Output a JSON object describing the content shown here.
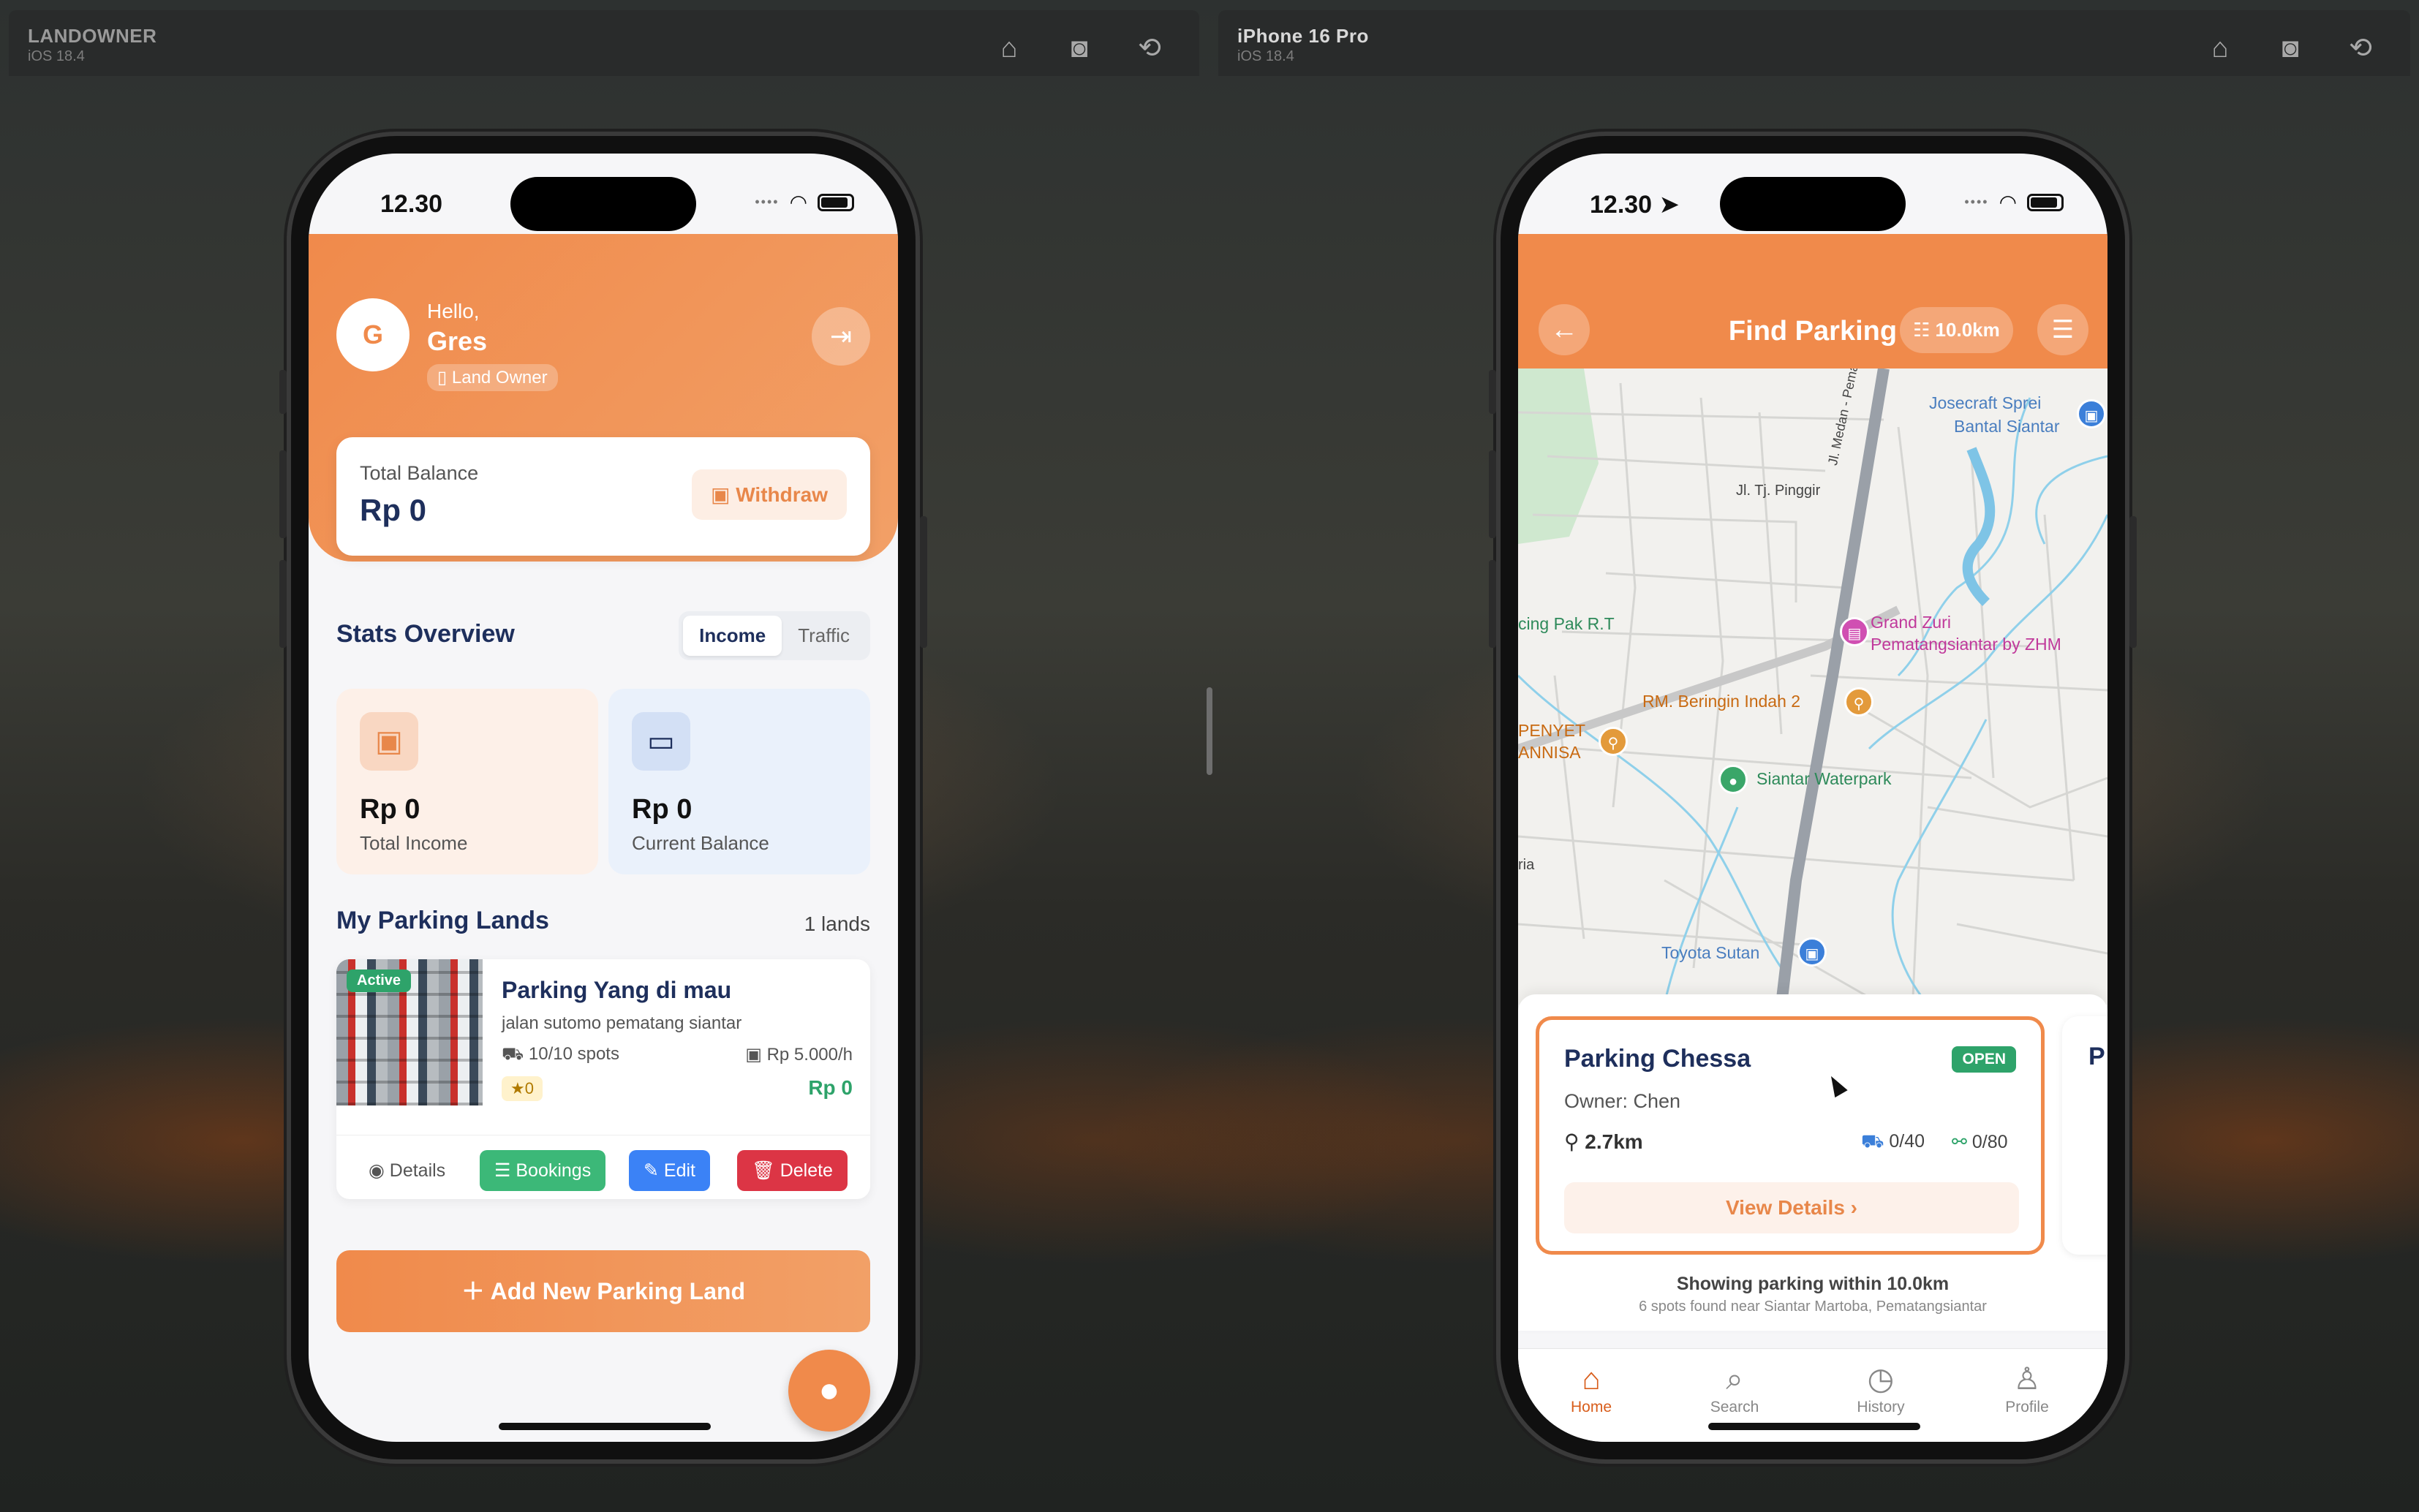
{
  "left_sim": {
    "title": "LANDOWNER",
    "os": "iOS 18.4"
  },
  "right_sim": {
    "title": "iPhone 16 Pro",
    "os": "iOS 18.4"
  },
  "sim_icons": [
    "home-icon",
    "screenshot-icon",
    "rotate-icon"
  ],
  "left_phone": {
    "time": "12.30",
    "user": {
      "initial": "G",
      "greeting": "Hello,",
      "name": "Gres",
      "role": "Land Owner"
    },
    "balance": {
      "label": "Total Balance",
      "value": "Rp 0",
      "withdraw_label": "Withdraw"
    },
    "stats": {
      "title": "Stats Overview",
      "tabs": [
        "Income",
        "Traffic"
      ],
      "active_tab": "Income",
      "cards": [
        {
          "value": "Rp 0",
          "label": "Total Income",
          "icon": "money-icon"
        },
        {
          "value": "Rp 0",
          "label": "Current Balance",
          "icon": "card-icon"
        }
      ]
    },
    "lands": {
      "title": "My Parking Lands",
      "count": "1 lands",
      "items": [
        {
          "status": "Active",
          "name": "Parking Yang di mau",
          "address": "jalan sutomo pematang siantar",
          "spots": "10/10 spots",
          "price": "Rp 5.000/h",
          "rating": "0",
          "earnings": "Rp 0",
          "actions": {
            "details": "Details",
            "bookings": "Bookings",
            "edit": "Edit",
            "delete": "Delete"
          }
        }
      ]
    },
    "add_button": "Add New Parking Land"
  },
  "right_phone": {
    "time": "12.30",
    "header": {
      "title": "Find Parking",
      "radius": "10.0km"
    },
    "map": {
      "labels": [
        {
          "text": "Josecraft Sprei",
          "kind": "poi-blue"
        },
        {
          "text": "Bantal Siantar",
          "kind": "poi-blue"
        },
        {
          "text": "Jl. Tj. Pinggir",
          "kind": "road"
        },
        {
          "text": "Jl. Medan - Pematang S",
          "kind": "road"
        },
        {
          "text": "cing Pak R.T",
          "kind": "poi-green"
        },
        {
          "text": "Grand Zuri",
          "kind": "poi-pink"
        },
        {
          "text": "Pematangsiantar by ZHM",
          "kind": "poi-pink"
        },
        {
          "text": "RM. Beringin Indah 2",
          "kind": "poi-orange"
        },
        {
          "text": "PENYET",
          "kind": "poi-orange"
        },
        {
          "text": "ANNISA",
          "kind": "poi-orange"
        },
        {
          "text": "Siantar Waterpark",
          "kind": "poi-green"
        },
        {
          "text": "ria",
          "kind": "road"
        },
        {
          "text": "Toyota Sutan",
          "kind": "poi-blue"
        }
      ]
    },
    "parking": {
      "name": "Parking Chessa",
      "status": "OPEN",
      "owner": "Owner: Chen",
      "distance": "2.7km",
      "cars": "0/40",
      "bikes": "0/80",
      "view_label": "View Details",
      "next_card_prefix": "P"
    },
    "showing": "Showing parking within 10.0km",
    "found": "6 spots found near Siantar Martoba, Pematangsiantar",
    "tabs": [
      {
        "label": "Home",
        "icon": "home-icon",
        "active": true
      },
      {
        "label": "Search",
        "icon": "search-icon",
        "active": false
      },
      {
        "label": "History",
        "icon": "clock-icon",
        "active": false
      },
      {
        "label": "Profile",
        "icon": "user-icon",
        "active": false
      }
    ]
  },
  "colors": {
    "primary": "#f08a4b",
    "navy": "#1e2f5c",
    "green": "#2ea36a",
    "blue": "#3b82f6",
    "red": "#dc3545"
  }
}
